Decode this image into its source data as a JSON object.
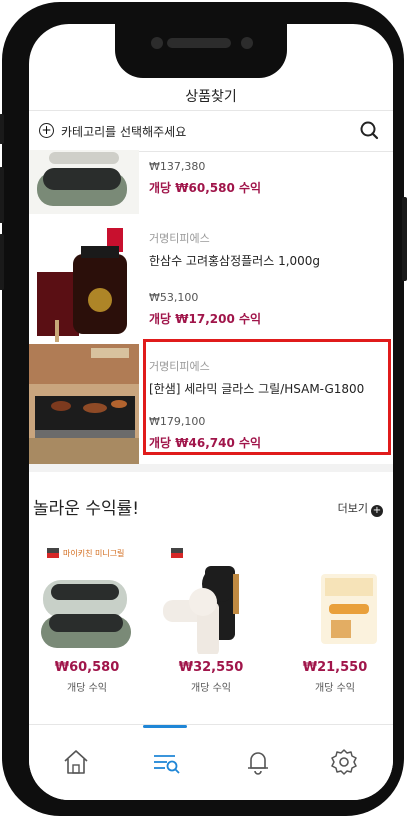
{
  "header": {
    "title": "상품찾기"
  },
  "category_bar": {
    "label": "카테고리를 선택해주세요"
  },
  "products": [
    {
      "seller": "",
      "name": "",
      "price": "₩137,380",
      "profit": "개당 ₩60,580 수익"
    },
    {
      "seller": "거명티피에스",
      "name": "한삼수 고려홍삼정플러스 1,000g",
      "price": "₩53,100",
      "profit": "개당 ₩17,200 수익"
    },
    {
      "seller": "거명티피에스",
      "name": "[한샘] 세라믹 글라스 그릴/HSAM-G1800",
      "price": "₩179,100",
      "profit": "개당 ₩46,740 수익"
    }
  ],
  "section": {
    "title": "놀라운 수익률!",
    "more_label": "더보기",
    "cards": [
      {
        "badge": "마이키친 미니그릴",
        "price": "₩60,580",
        "label": "개당 수익"
      },
      {
        "badge": "",
        "price": "₩32,550",
        "label": "개당 수익"
      },
      {
        "badge": "",
        "price": "₩21,550",
        "label": "개당 수익"
      }
    ]
  },
  "colors": {
    "accent": "#a0154a",
    "highlight": "#e01b1b",
    "tab_active": "#1f86d6"
  },
  "tabs": [
    {
      "icon": "home-icon"
    },
    {
      "icon": "list-search-icon"
    },
    {
      "icon": "bell-icon"
    },
    {
      "icon": "settings-icon"
    }
  ]
}
